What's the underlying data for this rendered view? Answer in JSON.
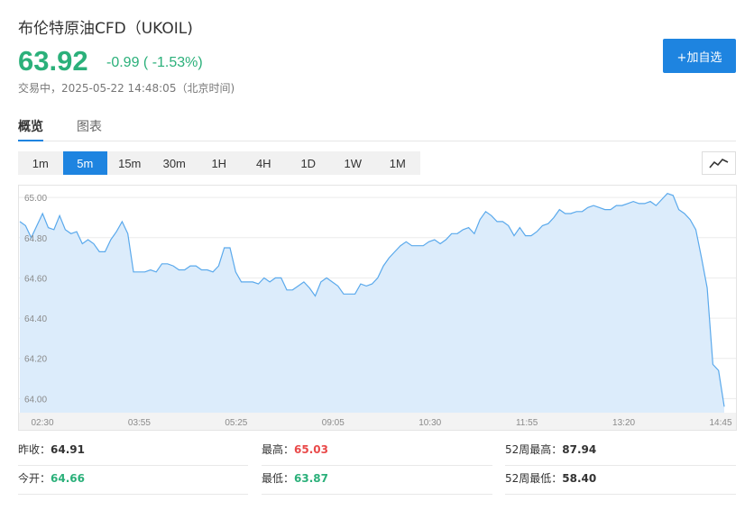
{
  "header": {
    "title": "布伦特原油CFD（UKOIL)",
    "price": "63.92",
    "change": "-0.99 ( -1.53%)",
    "status": "交易中，2025-05-22 14:48:05（北京时间)",
    "add_button": "+加自选"
  },
  "tabs": [
    {
      "label": "概览",
      "active": true
    },
    {
      "label": "图表",
      "active": false
    }
  ],
  "periods": [
    {
      "label": "1m",
      "active": false
    },
    {
      "label": "5m",
      "active": true
    },
    {
      "label": "15m",
      "active": false
    },
    {
      "label": "30m",
      "active": false
    },
    {
      "label": "1H",
      "active": false
    },
    {
      "label": "4H",
      "active": false
    },
    {
      "label": "1D",
      "active": false
    },
    {
      "label": "1W",
      "active": false
    },
    {
      "label": "1M",
      "active": false
    }
  ],
  "chart_type_icon": "line-chart-icon",
  "colors": {
    "accent": "#1e84e0",
    "down": "#2bb07a",
    "up": "#e94a4a",
    "line": "#5aa9ec",
    "area": "#dcecfb"
  },
  "chart_data": {
    "type": "area",
    "title": "",
    "xlabel": "",
    "ylabel": "",
    "ylim": [
      63.93,
      65.05
    ],
    "yticks": [
      "65.00",
      "64.80",
      "64.60",
      "64.40",
      "64.20",
      "64.00"
    ],
    "xticks": [
      "02:30",
      "03:55",
      "05:25",
      "09:05",
      "10:30",
      "11:55",
      "13:20",
      "14:45"
    ],
    "grid": true,
    "series": [
      {
        "values": [
          64.88,
          64.86,
          64.8,
          64.86,
          64.92,
          64.85,
          64.84,
          64.91,
          64.84,
          64.82,
          64.83,
          64.77,
          64.79,
          64.77,
          64.73,
          64.73,
          64.79,
          64.83,
          64.88,
          64.82,
          64.63,
          64.63,
          64.63,
          64.64,
          64.63,
          64.67,
          64.67,
          64.66,
          64.64,
          64.64,
          64.66,
          64.66,
          64.64,
          64.64,
          64.63,
          64.66,
          64.75,
          64.75,
          64.63,
          64.58,
          64.58,
          64.58,
          64.57,
          64.6,
          64.58,
          64.6,
          64.6,
          64.54,
          64.54,
          64.56,
          64.58,
          64.55,
          64.51,
          64.58,
          64.6,
          64.58,
          64.56,
          64.52,
          64.52,
          64.52,
          64.57,
          64.56,
          64.57,
          64.6,
          64.66,
          64.7,
          64.73,
          64.76,
          64.78,
          64.76,
          64.76,
          64.76,
          64.78,
          64.79,
          64.77,
          64.79,
          64.82,
          64.82,
          64.84,
          64.85,
          64.82,
          64.89,
          64.93,
          64.91,
          64.88,
          64.88,
          64.86,
          64.81,
          64.85,
          64.81,
          64.81,
          64.83,
          64.86,
          64.87,
          64.9,
          64.94,
          64.92,
          64.92,
          64.93,
          64.93,
          64.95,
          64.96,
          64.95,
          64.94,
          64.94,
          64.96,
          64.96,
          64.97,
          64.98,
          64.97,
          64.97,
          64.98,
          64.96,
          64.99,
          65.02,
          65.01,
          64.94,
          64.92,
          64.89,
          64.84,
          64.7,
          64.55,
          64.17,
          64.14,
          63.96
        ]
      }
    ]
  },
  "stats": [
    {
      "label": "昨收：",
      "value": "64.91",
      "tone": "neutral"
    },
    {
      "label": "最高：",
      "value": "65.03",
      "tone": "up"
    },
    {
      "label": "52周最高：",
      "value": "87.94",
      "tone": "neutral"
    },
    {
      "label": "今开：",
      "value": "64.66",
      "tone": "down"
    },
    {
      "label": "最低：",
      "value": "63.87",
      "tone": "down"
    },
    {
      "label": "52周最低：",
      "value": "58.40",
      "tone": "neutral"
    }
  ]
}
